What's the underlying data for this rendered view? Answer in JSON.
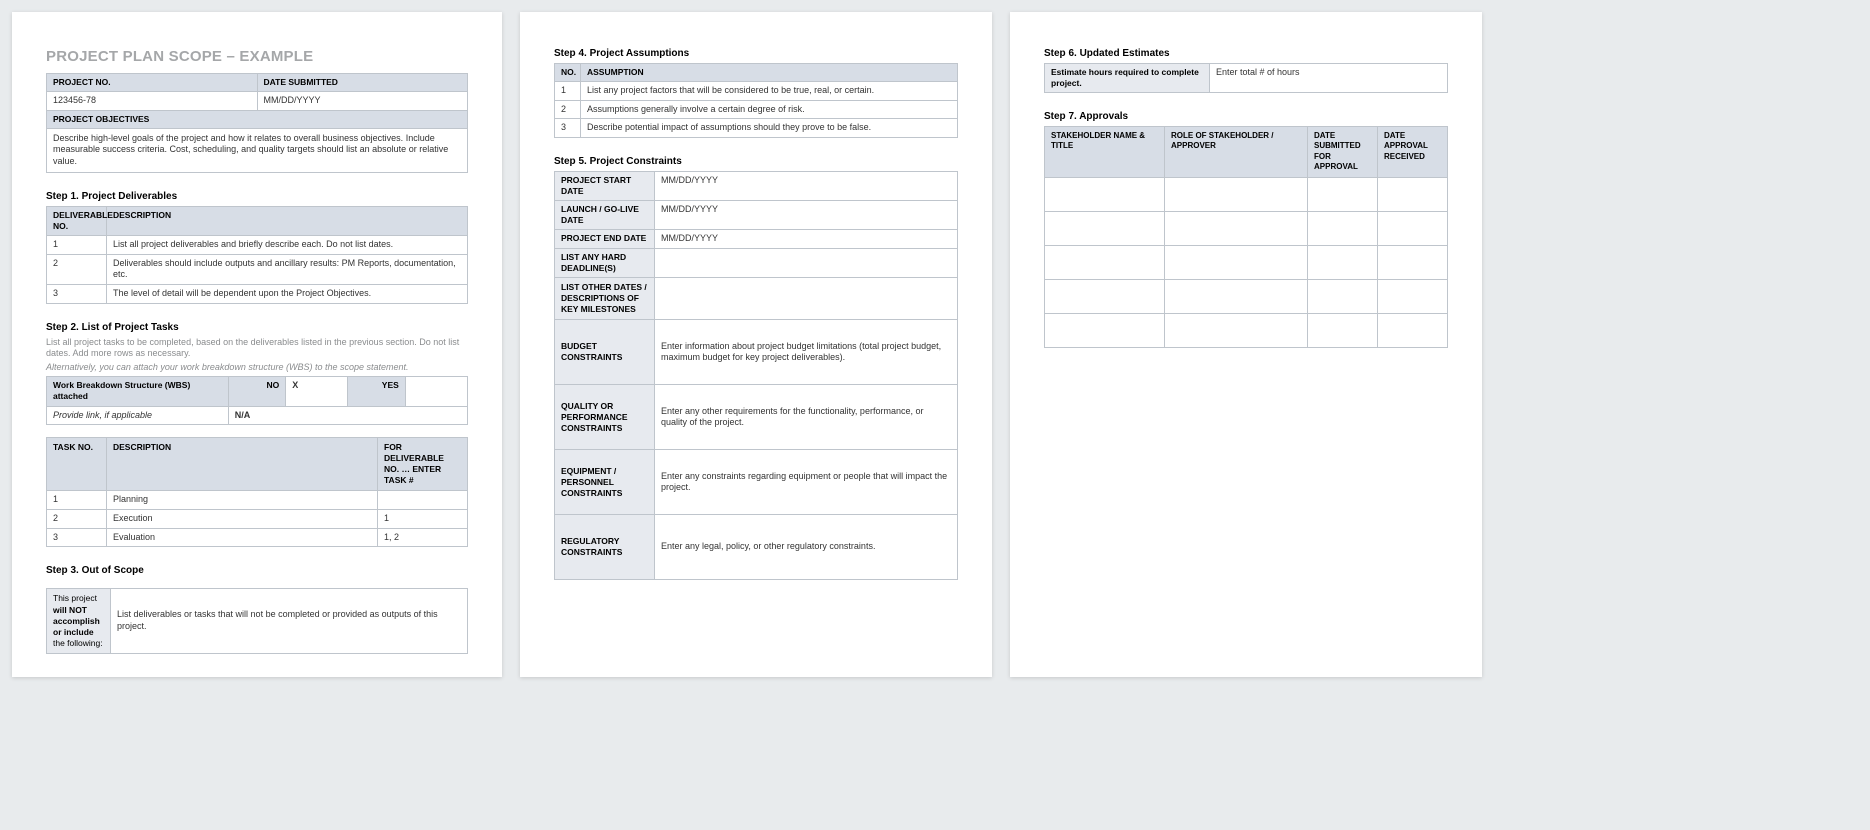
{
  "title": "PROJECT PLAN SCOPE – EXAMPLE",
  "meta": {
    "project_no_label": "PROJECT NO.",
    "project_no": "123456-78",
    "date_submitted_label": "DATE SUBMITTED",
    "date_submitted": "MM/DD/YYYY",
    "objectives_label": "PROJECT OBJECTIVES",
    "objectives_text": "Describe high-level goals of the project and how it relates to overall business objectives.  Include measurable success criteria.  Cost, scheduling, and quality targets should list an absolute or relative value."
  },
  "step1": {
    "heading": "Step 1. Project Deliverables",
    "col_no": "DELIVERABLE NO.",
    "col_desc": "DESCRIPTION",
    "rows": [
      {
        "no": "1",
        "desc": "List all project deliverables and briefly describe each. Do not list dates."
      },
      {
        "no": "2",
        "desc": "Deliverables should include outputs and ancillary results: PM Reports, documentation, etc."
      },
      {
        "no": "3",
        "desc": "The level of detail will be dependent upon the Project Objectives."
      }
    ]
  },
  "step2": {
    "heading": "Step 2. List of Project Tasks",
    "sub1": "List all project tasks to be completed, based on the deliverables listed in the previous section. Do not list dates. Add more rows as necessary.",
    "sub2": "Alternatively, you can attach your work breakdown structure (WBS) to the scope statement.",
    "wbs_label": "Work Breakdown Structure (WBS) attached",
    "no_label": "NO",
    "no_val": "X",
    "yes_label": "YES",
    "yes_val": "",
    "link_label": "Provide link, if applicable",
    "link_val": "N/A",
    "col_no": "TASK NO.",
    "col_desc": "DESCRIPTION",
    "col_for": "FOR DELIVERABLE NO. … ENTER TASK #",
    "rows": [
      {
        "no": "1",
        "desc": "Planning",
        "for": ""
      },
      {
        "no": "2",
        "desc": "Execution",
        "for": "1"
      },
      {
        "no": "3",
        "desc": "Evaluation",
        "for": "1, 2"
      }
    ]
  },
  "step3": {
    "heading": "Step 3. Out of Scope",
    "lead_pre": "This project ",
    "lead_bold": "will NOT accomplish or include",
    "lead_post": " the following:",
    "text": "List deliverables or tasks that will not be completed or provided as outputs of this project."
  },
  "step4": {
    "heading": "Step 4. Project Assumptions",
    "col_no": "NO.",
    "col_a": "ASSUMPTION",
    "rows": [
      {
        "no": "1",
        "a": "List any project factors that will be considered to be true, real, or certain."
      },
      {
        "no": "2",
        "a": "Assumptions generally involve a certain degree of risk."
      },
      {
        "no": "3",
        "a": "Describe potential impact of assumptions should they prove to be false."
      }
    ]
  },
  "step5": {
    "heading": "Step 5. Project Constraints",
    "labels": {
      "start": "PROJECT START DATE",
      "golive": "LAUNCH / GO-LIVE DATE",
      "end": "PROJECT END DATE",
      "hard": "LIST ANY HARD DEADLINE(S)",
      "other": "LIST OTHER DATES / DESCRIPTIONS OF KEY MILESTONES",
      "budget": "BUDGET CONSTRAINTS",
      "quality": "QUALITY OR PERFORMANCE CONSTRAINTS",
      "equip": "EQUIPMENT / PERSONNEL CONSTRAINTS",
      "reg": "REGULATORY CONSTRAINTS"
    },
    "vals": {
      "start": "MM/DD/YYYY",
      "golive": "MM/DD/YYYY",
      "end": "MM/DD/YYYY",
      "hard": "",
      "other": "",
      "budget": "Enter information about project budget limitations (total project budget, maximum budget for key project deliverables).",
      "quality": "Enter any other requirements for the functionality, performance, or quality of the project.",
      "equip": "Enter any constraints regarding equipment or people that will impact the project.",
      "reg": "Enter any legal, policy, or other regulatory constraints."
    }
  },
  "step6": {
    "heading": "Step 6. Updated Estimates",
    "label": "Estimate hours required to complete project.",
    "val": "Enter total # of hours"
  },
  "step7": {
    "heading": "Step 7. Approvals",
    "col1": "STAKEHOLDER NAME & TITLE",
    "col2": "ROLE OF STAKEHOLDER / APPROVER",
    "col3": "DATE SUBMITTED FOR APPROVAL",
    "col4": "DATE APPROVAL RECEIVED"
  }
}
